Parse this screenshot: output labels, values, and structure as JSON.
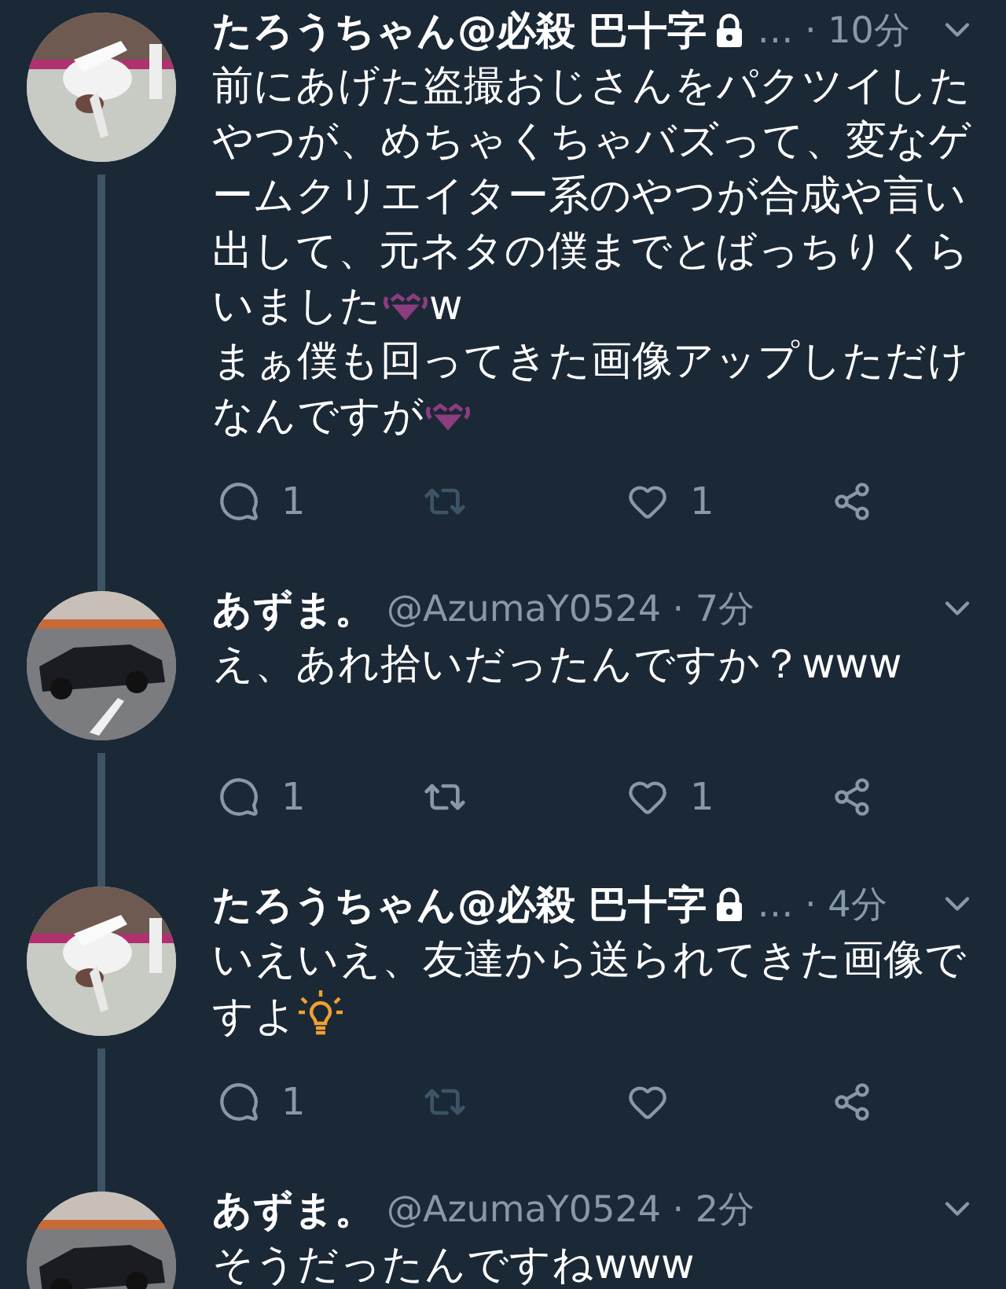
{
  "tweets": [
    {
      "author": "たろうちゃん@必殺 巴十字",
      "protected": true,
      "meta": "… · 10分",
      "body": [
        [
          {
            "kind": "text",
            "text": "前にあげた盗撮おじさんをパクツイしたやつが、めちゃくちゃバズって、変なゲームクリエイター系のやつが合成や言い出して、元ネタの僕までとばっちりくらいました"
          },
          {
            "kind": "laugh"
          },
          {
            "kind": "text",
            "text": "w"
          }
        ],
        [
          {
            "kind": "text",
            "text": "まぁ僕も回ってきた画像アップしただけなんですが"
          },
          {
            "kind": "laugh"
          }
        ]
      ],
      "actions": {
        "reply_count": "1",
        "retweet_disabled": true,
        "like_count": "1"
      }
    },
    {
      "author": "あずま。",
      "protected": false,
      "meta": "@AzumaY0524 · 7分",
      "body": [
        [
          {
            "kind": "text",
            "text": "え、あれ拾いだったんですか？www"
          }
        ]
      ],
      "actions": {
        "reply_count": "1",
        "retweet_disabled": false,
        "like_count": "1"
      }
    },
    {
      "author": "たろうちゃん@必殺 巴十字",
      "protected": true,
      "meta": "… · 4分",
      "body": [
        [
          {
            "kind": "text",
            "text": "いえいえ、友達から送られてきた画像ですよ"
          },
          {
            "kind": "bulb"
          }
        ]
      ],
      "actions": {
        "reply_count": "1",
        "retweet_disabled": true
      }
    },
    {
      "author": "あずま。",
      "protected": false,
      "meta": "@AzumaY0524 · 2分",
      "body": [
        [
          {
            "kind": "text",
            "text": "そうだったんですねwww"
          }
        ]
      ]
    }
  ]
}
